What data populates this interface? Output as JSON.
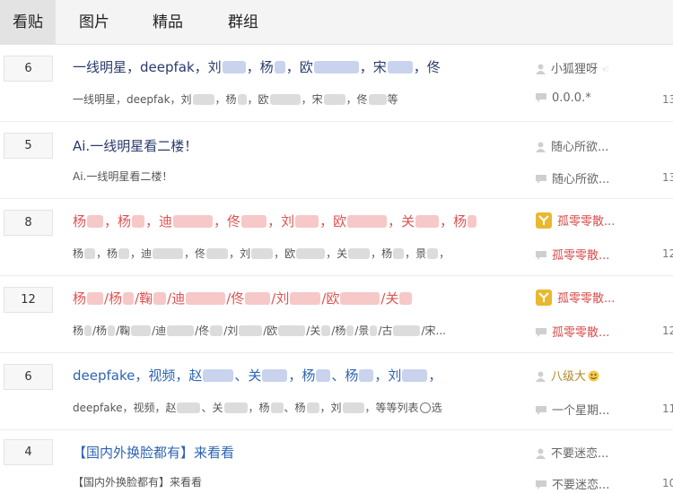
{
  "tabs": [
    "看贴",
    "图片",
    "精品",
    "群组"
  ],
  "rows": [
    {
      "reply": "6",
      "title_parts": [
        "一线明星，deepfak，刘",
        "，杨",
        "，欧",
        "，宋",
        "，佟"
      ],
      "abstract_parts": [
        "一线明星，deepfak，刘",
        "，杨",
        "，欧",
        "，宋",
        "，佟",
        "等"
      ],
      "author": "小狐狸呀",
      "last_reply": "0.0.0.*",
      "date": "13"
    },
    {
      "reply": "5",
      "title_parts": [
        "Ai.一线明星看二楼！"
      ],
      "abstract_parts": [
        "Ai.一线明星看二楼！"
      ],
      "author": "随心所欲...",
      "last_reply": "随心所欲...",
      "date": "13"
    },
    {
      "reply": "8",
      "title_parts": [
        "杨",
        "，杨",
        "，迪",
        "，佟",
        "，刘",
        "，欧",
        "，关",
        "，杨"
      ],
      "abstract_parts": [
        "杨",
        "，杨",
        "，迪",
        "，佟",
        "，刘",
        "，欧",
        "，关",
        "，杨",
        "，景",
        "，"
      ],
      "author": "孤零零散...",
      "last_reply": "孤零零散...",
      "date": "12"
    },
    {
      "reply": "12",
      "title_parts": [
        "杨",
        "/杨",
        "/鞠",
        "/迪",
        "/佟",
        "/刘",
        "/欧",
        "/关"
      ],
      "abstract_parts": [
        "杨",
        "/杨",
        "/鞠",
        "/迪",
        "/佟",
        "/刘",
        "/欧",
        "/关",
        "/杨",
        "/景",
        "/古",
        "/宋..."
      ],
      "author": "孤零零散...",
      "last_reply": "孤零零散...",
      "date": "12"
    },
    {
      "reply": "6",
      "title_parts": [
        "deepfake，视频，赵",
        "、关",
        "，杨",
        "、杨",
        "，刘",
        "，"
      ],
      "abstract_parts": [
        "deepfake，视频，赵",
        "、关",
        "，杨",
        "、杨",
        "，刘",
        "，等等列表",
        "选"
      ],
      "author": "八级大",
      "last_reply": "一个星期...",
      "date": "11"
    },
    {
      "reply": "4",
      "title_parts": [
        "【国内外换脸都有】来看看"
      ],
      "abstract_parts": [
        "【国内外换脸都有】来看看"
      ],
      "author": "不要迷恋...",
      "last_reply": "不要迷恋...",
      "date": "10"
    }
  ],
  "colors": {
    "title_red": "#e05151",
    "title_blue": "#2d64b3",
    "title_navy": "#2a3a6b",
    "blur_red": "#f6c8c8",
    "blur_blue": "#c9d3ee",
    "blur_gray": "#dcdcdc",
    "badge_gold": "#e8b830"
  }
}
